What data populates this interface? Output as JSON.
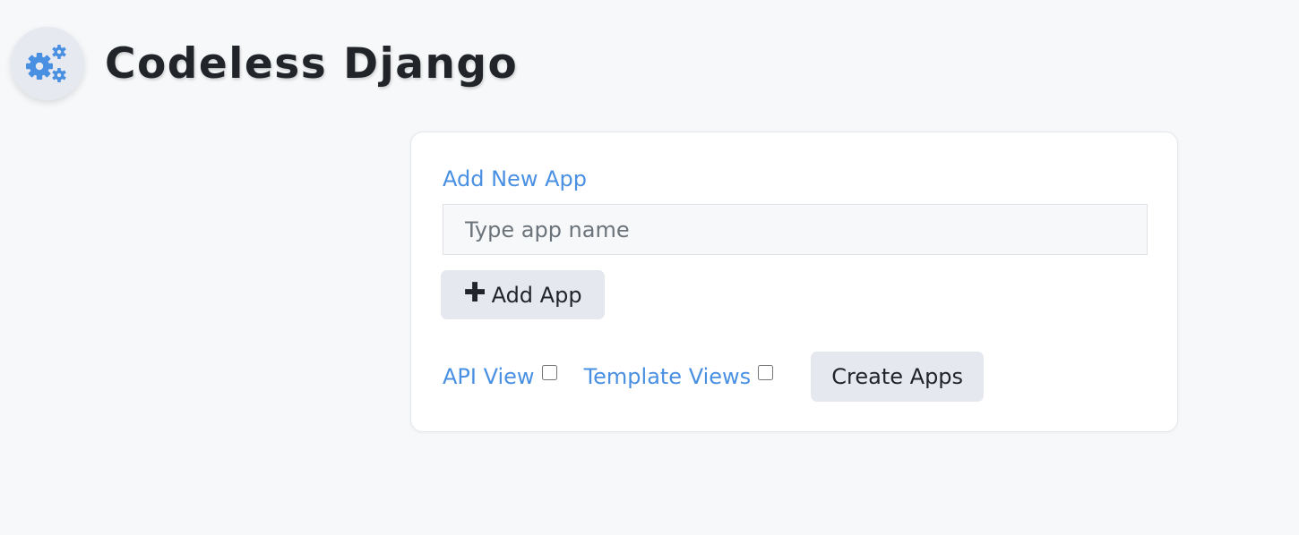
{
  "header": {
    "title": "Codeless Django",
    "logo_icon": "gears-icon",
    "accent_color": "#4a90e2"
  },
  "form": {
    "section_label": "Add New App",
    "app_name_input": {
      "value": "",
      "placeholder": "Type app name"
    },
    "add_button": {
      "icon": "plus-icon",
      "icon_glyph": "✚",
      "label": "Add App"
    },
    "options": {
      "api_view": {
        "label": "API View",
        "checked": false
      },
      "template_views": {
        "label": "Template Views",
        "checked": false
      }
    },
    "create_button": {
      "label": "Create Apps"
    }
  }
}
